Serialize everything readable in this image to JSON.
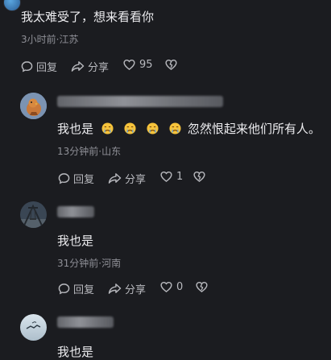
{
  "comments": [
    {
      "text": "我太难受了，想来看看你",
      "meta": "3小时前·江苏",
      "reply_label": "回复",
      "share_label": "分享",
      "likes": "95"
    },
    {
      "text_prefix": "我也是",
      "text_suffix": "忽然恨起来他们所有人。",
      "meta": "13分钟前·山东",
      "reply_label": "回复",
      "share_label": "分享",
      "likes": "1"
    },
    {
      "text": "我也是",
      "meta": "31分钟前·河南",
      "reply_label": "回复",
      "share_label": "分享",
      "likes": "0"
    },
    {
      "text": "我也是"
    }
  ],
  "icons": {
    "emoji": "crying-face-icon",
    "reply": "comment-bubble-icon",
    "share": "share-arrow-icon",
    "like": "heart-icon",
    "dislike": "broken-heart-icon"
  },
  "colors": {
    "background": "#1b1c20",
    "text": "#ececef",
    "meta": "#8f9097",
    "emoji_face": "#f6c33b",
    "emoji_tear": "#4aa3ff"
  }
}
